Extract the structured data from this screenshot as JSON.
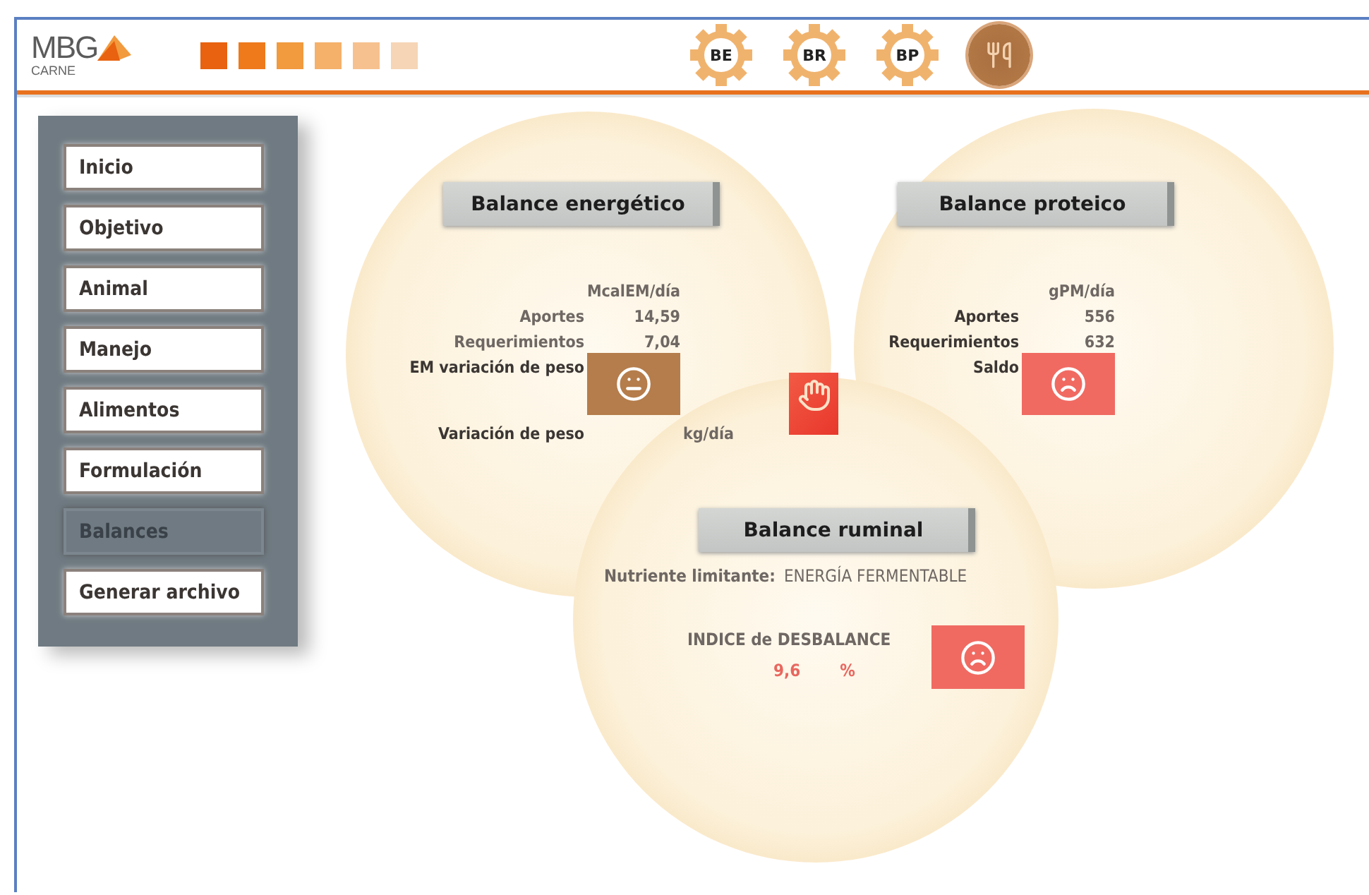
{
  "header": {
    "logo": {
      "name": "MBG",
      "sub": "CARNE"
    },
    "steps": [
      {
        "color": "#e8620f"
      },
      {
        "color": "#ee7a1c"
      },
      {
        "color": "#f29a3e"
      },
      {
        "color": "#f5b06a"
      },
      {
        "color": "#f6c18e"
      },
      {
        "color": "#f5d5b6"
      }
    ],
    "badges": [
      {
        "kind": "gear",
        "label": "BE"
      },
      {
        "kind": "gear",
        "label": "BR"
      },
      {
        "kind": "gear",
        "label": "BP"
      },
      {
        "kind": "round"
      }
    ]
  },
  "sidebar": {
    "items": [
      {
        "label": "Inicio",
        "selected": false
      },
      {
        "label": "Objetivo",
        "selected": false
      },
      {
        "label": "Animal",
        "selected": false
      },
      {
        "label": "Manejo",
        "selected": false
      },
      {
        "label": "Alimentos",
        "selected": false
      },
      {
        "label": "Formulación",
        "selected": false
      },
      {
        "label": "Balances",
        "selected": true
      },
      {
        "label": "Generar archivo",
        "selected": false
      }
    ]
  },
  "energy": {
    "title": "Balance energético",
    "unit": "McalEM/día",
    "rows": [
      {
        "label": "Aportes",
        "value": "14,59"
      },
      {
        "label": "Requerimientos",
        "value": "7,04"
      }
    ],
    "status_label": "EM variación de peso",
    "indicator": {
      "kind": "neutral"
    },
    "warning": true,
    "weight_label": "Variación de peso",
    "weight_unit": "kg/día"
  },
  "protein": {
    "title": "Balance proteico",
    "unit": "gPM/día",
    "rows": [
      {
        "label": "Aportes",
        "value": "556"
      },
      {
        "label": "Requerimientos",
        "value": "632"
      }
    ],
    "status_label": "Saldo",
    "indicator": {
      "kind": "bad"
    }
  },
  "ruminal": {
    "title": "Balance ruminal",
    "limit_label": "Nutriente limitante:",
    "limit_value": "ENERGÍA FERMENTABLE",
    "index_label": "INDICE de DESBALANCE",
    "index_value": "9,6",
    "index_unit": "%",
    "indicator": {
      "kind": "bad"
    }
  }
}
